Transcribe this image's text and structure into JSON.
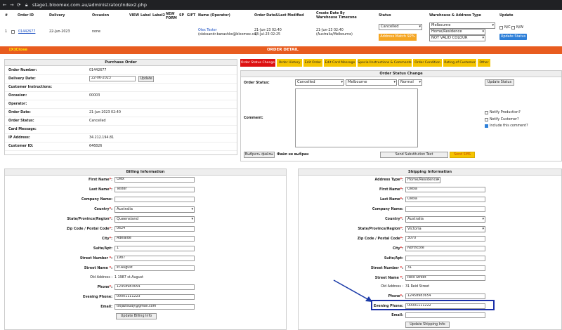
{
  "browser": {
    "url": "stage1.bloomex.com.au/administrator/index2.php"
  },
  "order_table": {
    "headers": [
      "#",
      "Order ID",
      "Delivery",
      "Occasion",
      "VIEW",
      "Label",
      "Label2",
      "NEW FORM",
      "SP",
      "GIFT",
      "Name (Operator)",
      "Order Date&Last Modified",
      "Create Date By Warehouse Timezone",
      "Status",
      "Warehouse & Address Type",
      "Update"
    ],
    "row": {
      "num": "1",
      "order_id": "01442677",
      "delivery": "22-Jun-2023",
      "occasion": "none",
      "name": "Olex Tester",
      "operator": "(oleksandr.banashko@bloomex.ca)",
      "order_date": "21-Jun-23 02:40",
      "modified": "13-Jul-23 02:25",
      "create_date": "21-Jun-23 02:40",
      "timezone": "(Australia/Melbourne)",
      "status": "Cancelled",
      "address_match": "Address Match 92%",
      "warehouse": "Melbourne",
      "address_type": "Home/Residence",
      "colour": "NOT VALID COLOUR",
      "nc_label": "N/C",
      "nw_label": "N/W",
      "update_status": "Update Status"
    }
  },
  "detail_bar": {
    "left": "[X]Close",
    "title": "ORDER DETAIL"
  },
  "purchase_order": {
    "title": "Purchase Order",
    "rows": [
      {
        "label": "Order Number:",
        "value": "01442677"
      },
      {
        "label": "Delivery Date:",
        "value": "22-06-2023"
      },
      {
        "label": "Customer Instructions:",
        "value": ""
      },
      {
        "label": "Occasion:",
        "value": "00003"
      },
      {
        "label": "Operator:",
        "value": ""
      },
      {
        "label": "Order Date:",
        "value": "21-Jun-2023 02:40"
      },
      {
        "label": "Order Status:",
        "value": "Cancelled"
      },
      {
        "label": "Card Message:",
        "value": ""
      },
      {
        "label": "IP Address:",
        "value": "34.212.194.81"
      },
      {
        "label": "Customer ID:",
        "value": "646826"
      }
    ],
    "update_btn": "Update"
  },
  "tabs": [
    "Order Status Change",
    "Order History",
    "Edit Order",
    "Edit Card Message",
    "Special Instructions & Comments",
    "Order Condition",
    "Rating of Customer",
    "Other"
  ],
  "status_change": {
    "title": "Order Status Change",
    "status_label": "Order Status:",
    "status_value": "Cancelled",
    "city_value": "Melbourne",
    "priority_value": "Normal",
    "update_btn": "Update Status",
    "comment_label": "Comment:",
    "notify_production": "Notify Production?",
    "notify_customer": "Notify Customer?",
    "include_comment": "Include this comment?",
    "choose_file": "Выбрать файлы",
    "no_file": "Файл не выбран",
    "send_substitution": "Send Substitution Text",
    "send_sms": "Send SMS"
  },
  "billing": {
    "title": "Billing Information",
    "first_name_label": "First Name",
    "first_name": "Olex",
    "last_name_label": "Last Name",
    "last_name": "Tester",
    "company_label": "Company Name:",
    "company": "",
    "country_label": "Country",
    "country": "Australia",
    "state_label": "State/Province/Region",
    "state": "Queensland",
    "zip_label": "Zip Code / Postal Code",
    "zip": "0624",
    "city_label": "City",
    "city": "Adelaide",
    "suite_label": "Suite/Apt:",
    "suite": "1",
    "street_num_label": "Street Number",
    "street_num": "1987",
    "street_name_label": "Street Name",
    "street_name": "st.August",
    "old_address_label": "Old Address :",
    "old_address": "1 1987 st.August",
    "phone_label": "Phone",
    "phone": "12458983654",
    "evening_label": "Evening Phone:",
    "evening": "00001111223",
    "email_label": "Email:",
    "email": "tstjaztsudy@gmail.com",
    "update_btn": "Update Billing Info"
  },
  "shipping": {
    "title": "Shipping Information",
    "address_type_label": "Address Type",
    "address_type": "Home/Residence",
    "first_name_label": "First Name",
    "first_name": "Olexa",
    "last_name_label": "Last Name",
    "last_name": "Olexa",
    "company_label": "Company Name:",
    "company": "",
    "country_label": "Country",
    "country": "Australia",
    "state_label": "State/Province/Region",
    "state": "Victoria",
    "zip_label": "Zip Code / Postal Code",
    "zip": "3070",
    "city_label": "City",
    "city": "Northcote",
    "suite_label": "Suite/Apt:",
    "suite": "",
    "street_num_label": "Street Number",
    "street_num": "31",
    "street_name_label": "Street Name",
    "street_name": "Reid Street",
    "old_address_label": "Old Address :",
    "old_address": "31 Reid Street",
    "phone_label": "Phone",
    "phone": "12458983654",
    "evening_label": "Evening Phone:",
    "evening": "00001111222",
    "email_label": "Email:",
    "email": "",
    "update_btn": "Update Shipping Info"
  },
  "colors": {
    "accent_orange": "#e85c1f",
    "tab_yellow": "#f5c400",
    "tab_active": "#dd1111",
    "highlight_box": "#1a2fa8",
    "arrow": "#1a3aa8"
  }
}
